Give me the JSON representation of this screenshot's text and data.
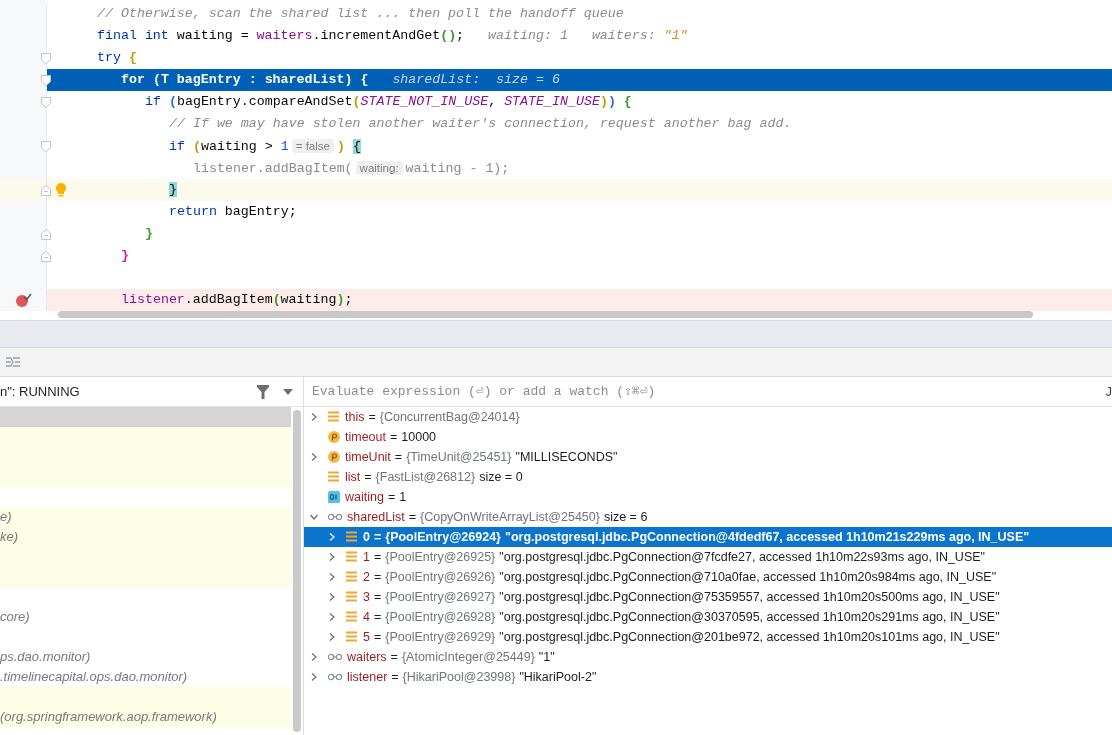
{
  "editor": {
    "lines": [
      {
        "kind": "plain",
        "current": false,
        "caret": false,
        "breakpoint": false,
        "intention": false,
        "tokens": [
          {
            "kind": "comment",
            "text": "// Otherwise, scan the shared list ... then poll the handoff queue"
          }
        ]
      },
      {
        "kind": "plain",
        "current": false,
        "caret": false,
        "breakpoint": false,
        "intention": false,
        "tokens": [
          {
            "kind": "keyword",
            "text": "final "
          },
          {
            "kind": "keyword",
            "text": "int "
          },
          {
            "kind": "plain",
            "text": "waiting = "
          },
          {
            "kind": "field",
            "text": "waiters"
          },
          {
            "kind": "plain",
            "text": ".incrementAndGet"
          },
          {
            "kind": "bracket",
            "text": "(",
            "color": "#3c9a2f"
          },
          {
            "kind": "bracket",
            "text": ")",
            "color": "#3c9a2f"
          },
          {
            "kind": "plain",
            "text": ";"
          },
          {
            "kind": "hint",
            "text": "waiting: 1"
          },
          {
            "kind": "hint",
            "text": "waiters: "
          },
          {
            "kind": "hint-string",
            "text": "\"1\""
          }
        ]
      },
      {
        "kind": "block-start",
        "current": false,
        "caret": false,
        "breakpoint": false,
        "intention": false,
        "tokens": [
          {
            "kind": "keyword",
            "text": "try "
          },
          {
            "kind": "bracket",
            "text": "{",
            "color": "#c49a00"
          }
        ],
        "children": [
          {
            "kind": "block-start",
            "current": true,
            "caret": false,
            "breakpoint": false,
            "intention": false,
            "tokens": [
              {
                "kind": "keyword",
                "text": "for "
              },
              {
                "kind": "plain",
                "text": "(T bagEntry : sharedList) {"
              },
              {
                "kind": "hint",
                "text": "sharedList:  size = 6"
              }
            ],
            "children": [
              {
                "kind": "block-start",
                "current": false,
                "caret": false,
                "breakpoint": false,
                "intention": false,
                "tokens": [
                  {
                    "kind": "keyword",
                    "text": "if "
                  },
                  {
                    "kind": "bracket",
                    "text": "(",
                    "color": "#2f6fbf"
                  },
                  {
                    "kind": "plain",
                    "text": "bagEntry.compareAndSet"
                  },
                  {
                    "kind": "bracket",
                    "text": "(",
                    "color": "#c49a00"
                  },
                  {
                    "kind": "constant",
                    "text": "STATE_NOT_IN_USE"
                  },
                  {
                    "kind": "plain",
                    "text": ", "
                  },
                  {
                    "kind": "constant",
                    "text": "STATE_IN_USE"
                  },
                  {
                    "kind": "bracket",
                    "text": ")",
                    "color": "#c49a00"
                  },
                  {
                    "kind": "bracket",
                    "text": ") ",
                    "color": "#2f6fbf"
                  },
                  {
                    "kind": "bracket",
                    "text": "{",
                    "color": "#3c9a2f"
                  }
                ],
                "children": [
                  {
                    "kind": "plain",
                    "current": false,
                    "caret": false,
                    "breakpoint": false,
                    "intention": false,
                    "tokens": [
                      {
                        "kind": "comment",
                        "text": "// If we may have stolen another waiter's connection, request another bag add."
                      }
                    ]
                  },
                  {
                    "kind": "block-start",
                    "current": false,
                    "caret": false,
                    "breakpoint": false,
                    "intention": false,
                    "tokens": [
                      {
                        "kind": "keyword",
                        "text": "if "
                      },
                      {
                        "kind": "bracket",
                        "text": "(",
                        "color": "#c49a00"
                      },
                      {
                        "kind": "plain",
                        "text": "waiting > "
                      },
                      {
                        "kind": "number",
                        "text": "1"
                      },
                      {
                        "kind": "chip",
                        "text": "= false"
                      },
                      {
                        "kind": "bracket",
                        "text": ") ",
                        "color": "#c49a00"
                      },
                      {
                        "kind": "match",
                        "text": "{"
                      }
                    ],
                    "children": [
                      {
                        "kind": "plain",
                        "current": false,
                        "caret": false,
                        "breakpoint": false,
                        "intention": false,
                        "tokens": [
                          {
                            "kind": "dead",
                            "text": "listener.addBagItem("
                          },
                          {
                            "kind": "chip",
                            "text": "waiting:"
                          },
                          {
                            "kind": "dead",
                            "text": "waiting - 1);"
                          }
                        ]
                      }
                    ]
                  },
                  {
                    "kind": "block-end",
                    "current": false,
                    "caret": true,
                    "breakpoint": false,
                    "intention": true,
                    "tokens": [
                      {
                        "kind": "match",
                        "text": "}"
                      }
                    ]
                  },
                  {
                    "kind": "plain",
                    "current": false,
                    "caret": false,
                    "breakpoint": false,
                    "intention": false,
                    "tokens": [
                      {
                        "kind": "keyword",
                        "text": "return "
                      },
                      {
                        "kind": "plain",
                        "text": "bagEntry;"
                      }
                    ]
                  }
                ]
              },
              {
                "kind": "block-end",
                "current": false,
                "caret": false,
                "breakpoint": false,
                "intention": false,
                "tokens": [
                  {
                    "kind": "bracket",
                    "text": "}",
                    "color": "#3c9a2f"
                  }
                ]
              }
            ]
          },
          {
            "kind": "block-end",
            "current": false,
            "caret": false,
            "breakpoint": false,
            "intention": false,
            "tokens": [
              {
                "kind": "bracket",
                "text": "}",
                "color": "#c8229b"
              }
            ]
          },
          {
            "kind": "plain",
            "current": false,
            "caret": false,
            "breakpoint": false,
            "intention": false
          },
          {
            "kind": "plain",
            "current": false,
            "caret": false,
            "breakpoint": true,
            "intention": false,
            "tokens": [
              {
                "kind": "field",
                "text": "listener"
              },
              {
                "kind": "plain",
                "text": ".addBagItem"
              },
              {
                "kind": "bracket",
                "text": "(",
                "color": "#3c9a2f"
              },
              {
                "kind": "plain",
                "text": "waiting"
              },
              {
                "kind": "bracket",
                "text": ")",
                "color": "#3c9a2f"
              },
              {
                "kind": "plain",
                "text": ";"
              }
            ]
          }
        ]
      }
    ]
  },
  "frames": {
    "header": "n\": RUNNING",
    "rows": [
      {
        "selected": true,
        "library": false
      },
      {
        "selected": false,
        "library": true
      },
      {
        "selected": false,
        "library": true
      },
      {
        "selected": false,
        "library": true
      },
      {
        "selected": false,
        "library": false
      },
      {
        "selected": false,
        "library": true,
        "text": "e)"
      },
      {
        "selected": false,
        "library": true,
        "text": "ke)"
      },
      {
        "selected": false,
        "library": true
      },
      {
        "selected": false,
        "library": true
      },
      {
        "selected": false,
        "library": false
      },
      {
        "selected": false,
        "library": false,
        "text": "core)"
      },
      {
        "selected": false,
        "library": false
      },
      {
        "selected": false,
        "library": false,
        "text": "ps.dao.monitor)"
      },
      {
        "selected": false,
        "library": false,
        "text": ".timelinecapital.ops.dao.monitor)"
      },
      {
        "selected": false,
        "library": true
      },
      {
        "selected": false,
        "library": true,
        "text": "(org.springframework.aop.framework)"
      }
    ]
  },
  "watch_field": {
    "placeholder": "Evaluate expression (⏎) or add a watch (⇧⌘⏎)",
    "column_2": "J"
  },
  "variables": [
    {
      "kind": "field",
      "expanded": false,
      "selected": false,
      "name": "this",
      "op": "=",
      "ref": "{ConcurrentBag@24014}"
    },
    {
      "kind": "param",
      "selected": false,
      "name": "timeout",
      "op": "=",
      "value": "10000"
    },
    {
      "kind": "param",
      "expanded": false,
      "selected": false,
      "name": "timeUnit",
      "op": "=",
      "ref": "{TimeUnit@25451}",
      "value": "\"MILLISECONDS\""
    },
    {
      "kind": "field",
      "selected": false,
      "name": "list",
      "op": "=",
      "ref": "{FastList@26812}",
      "value": "size = 0"
    },
    {
      "kind": "primitive",
      "selected": false,
      "name": "waiting",
      "op": "=",
      "value": "1"
    },
    {
      "kind": "watch",
      "expanded": true,
      "selected": false,
      "name": "sharedList",
      "op": "=",
      "ref": "{CopyOnWriteArrayList@25450}",
      "value": "size = 6",
      "children": [
        {
          "kind": "field",
          "expanded": false,
          "selected": true,
          "name": "0",
          "op": "=",
          "ref": "{PoolEntry@26924}",
          "value": "\"org.postgresql.jdbc.PgConnection@4fdedf67, accessed 1h10m21s229ms ago, IN_USE\""
        },
        {
          "kind": "field",
          "expanded": false,
          "selected": false,
          "name": "1",
          "op": "=",
          "ref": "{PoolEntry@26925}",
          "value": "\"org.postgresql.jdbc.PgConnection@7fcdfe27, accessed 1h10m22s93ms ago, IN_USE\""
        },
        {
          "kind": "field",
          "expanded": false,
          "selected": false,
          "name": "2",
          "op": "=",
          "ref": "{PoolEntry@26926}",
          "value": "\"org.postgresql.jdbc.PgConnection@710a0fae, accessed 1h10m20s984ms ago, IN_USE\""
        },
        {
          "kind": "field",
          "expanded": false,
          "selected": false,
          "name": "3",
          "op": "=",
          "ref": "{PoolEntry@26927}",
          "value": "\"org.postgresql.jdbc.PgConnection@75359557, accessed 1h10m20s500ms ago, IN_USE\""
        },
        {
          "kind": "field",
          "expanded": false,
          "selected": false,
          "name": "4",
          "op": "=",
          "ref": "{PoolEntry@26928}",
          "value": "\"org.postgresql.jdbc.PgConnection@30370595, accessed 1h10m20s291ms ago, IN_USE\""
        },
        {
          "kind": "field",
          "expanded": false,
          "selected": false,
          "name": "5",
          "op": "=",
          "ref": "{PoolEntry@26929}",
          "value": "\"org.postgresql.jdbc.PgConnection@201be972, accessed 1h10m20s101ms ago, IN_USE\""
        }
      ]
    },
    {
      "kind": "watch",
      "expanded": false,
      "selected": false,
      "name": "waiters",
      "op": "=",
      "ref": "{AtomicInteger@25449}",
      "value": "\"1\""
    },
    {
      "kind": "watch",
      "expanded": false,
      "selected": false,
      "name": "listener",
      "op": "=",
      "ref": "{HikariPool@23998}",
      "value": "\"HikariPool-2\""
    }
  ]
}
